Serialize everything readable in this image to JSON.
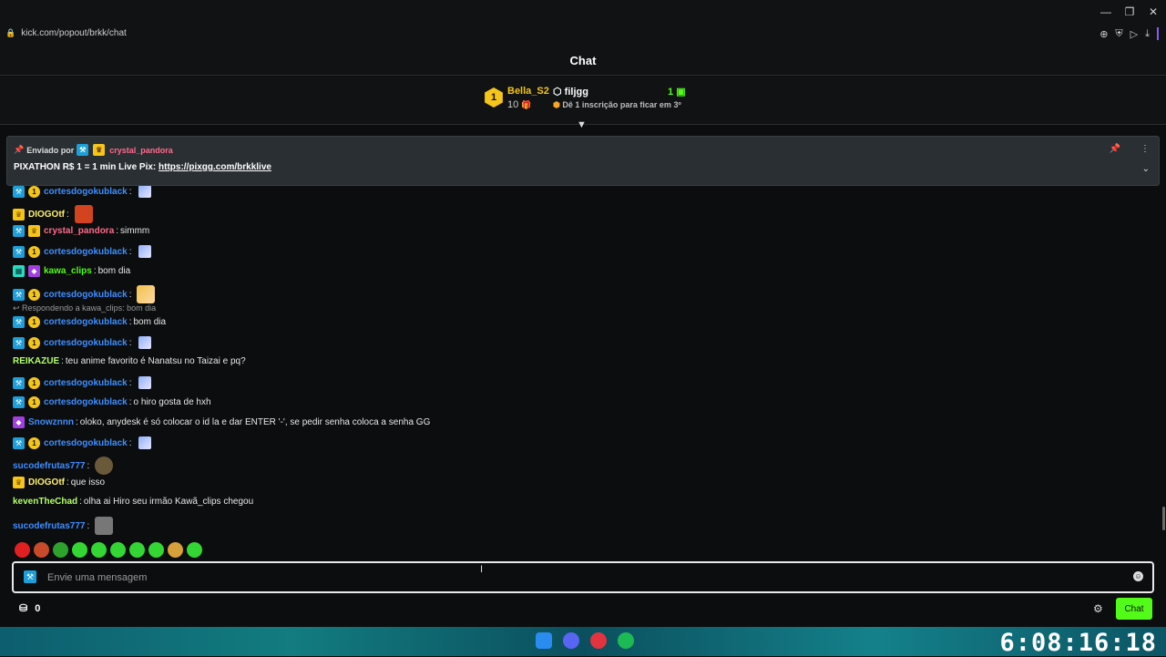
{
  "browser": {
    "url": "kick.com/popout/brkk/chat",
    "window_controls": [
      "minimize-icon",
      "restore-icon",
      "close-icon"
    ],
    "tool_icons": [
      "zoom-icon",
      "shield-icon",
      "send-icon",
      "download-icon"
    ]
  },
  "header": {
    "title": "Chat"
  },
  "leaderboard": {
    "rank": "1",
    "top_name": "Bella_S2",
    "top_count": "10",
    "user": "filjgg",
    "user_hint": "Dê 1 inscrição para ficar em 3º",
    "user_count": "1"
  },
  "pinned": {
    "sent_by_label": "Enviado por",
    "sender": "crystal_pandora",
    "text_prefix": "PIXATHON R$ 1 = 1 min Live Pix: ",
    "link": "https://pixgg.com/brkklive"
  },
  "messages": [
    {
      "user": "cortesdogokublack",
      "text": "",
      "color": "#3f8fff",
      "badges": [
        "blue",
        "num"
      ],
      "emote": "small"
    },
    {
      "user": "DIOGOtf",
      "text": "",
      "color": "#fff06b",
      "badges": [
        "crown"
      ],
      "emote": "face"
    },
    {
      "user": "crystal_pandora",
      "text": "simmm",
      "color": "#ff6b8a",
      "badges": [
        "blue",
        "crown"
      ],
      "emote": ""
    },
    {
      "user": "cortesdogokublack",
      "text": "",
      "color": "#3f8fff",
      "badges": [
        "blue",
        "num"
      ],
      "emote": "small"
    },
    {
      "user": "kawa_clips",
      "text": "bom dia",
      "color": "#53fc18",
      "badges": [
        "green",
        "purple"
      ],
      "emote": ""
    },
    {
      "user": "cortesdogokublack",
      "text": "",
      "color": "#3f8fff",
      "badges": [
        "blue",
        "num"
      ],
      "emote": "anime"
    },
    {
      "user": "cortesdogokublack",
      "text": "bom dia",
      "color": "#3f8fff",
      "badges": [
        "blue",
        "num"
      ],
      "emote": "",
      "reply": "Respondendo a kawa_clips: bom dia"
    },
    {
      "user": "cortesdogokublack",
      "text": "",
      "color": "#3f8fff",
      "badges": [
        "blue",
        "num"
      ],
      "emote": "small"
    },
    {
      "user": "REIKAZUE",
      "text": "teu anime favorito é Nanatsu no Taizai e pq?",
      "color": "#b6ff6b",
      "badges": [],
      "emote": ""
    },
    {
      "user": "cortesdogokublack",
      "text": "",
      "color": "#3f8fff",
      "badges": [
        "blue",
        "num"
      ],
      "emote": "small"
    },
    {
      "user": "cortesdogokublack",
      "text": "o hiro gosta de hxh",
      "color": "#3f8fff",
      "badges": [
        "blue",
        "num"
      ],
      "emote": ""
    },
    {
      "user": "Snowznnn",
      "text": "oloko, anydesk é só colocar o id la e dar ENTER '-', se pedir senha coloca a senha GG",
      "color": "#3f8fff",
      "badges": [
        "purple"
      ],
      "emote": ""
    },
    {
      "user": "cortesdogokublack",
      "text": "",
      "color": "#3f8fff",
      "badges": [
        "blue",
        "num"
      ],
      "emote": "small"
    },
    {
      "user": "sucodefrutas777",
      "text": "",
      "color": "#3f8fff",
      "badges": [],
      "emote": "dark"
    },
    {
      "user": "DIOGOtf",
      "text": "que isso",
      "color": "#fff06b",
      "badges": [
        "crown"
      ],
      "emote": ""
    },
    {
      "user": "kevenTheChad",
      "text": "olha ai Hiro seu irmão Kawã_clips chegou",
      "color": "#b6ff6b",
      "badges": [],
      "emote": ""
    },
    {
      "user": "sucodefrutas777",
      "text": "",
      "color": "#3f8fff",
      "badges": [],
      "emote": "gray"
    }
  ],
  "input": {
    "placeholder": "Envie uma mensagem"
  },
  "footer": {
    "store_count": "0",
    "chat_button": "Chat"
  },
  "clock": "6:08:16:18",
  "colors": {
    "accent": "#53fc18",
    "gold": "#f5c518"
  }
}
